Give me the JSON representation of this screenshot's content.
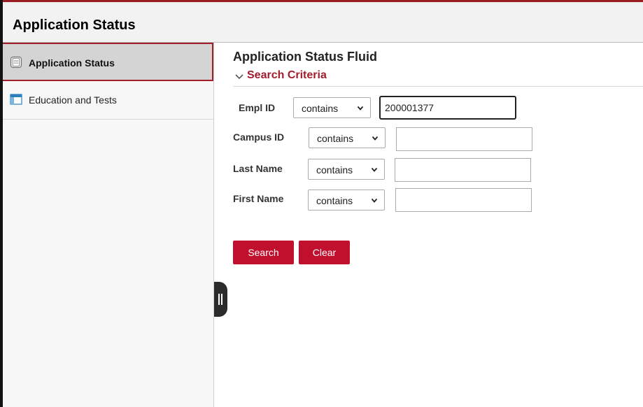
{
  "header": {
    "title": "Application Status"
  },
  "sidebar": {
    "items": [
      {
        "label": "Application Status",
        "icon": "document-icon",
        "active": true
      },
      {
        "label": "Education and Tests",
        "icon": "window-grid-icon",
        "active": false
      }
    ]
  },
  "main": {
    "page_title": "Application Status Fluid",
    "section_label": "Search Criteria",
    "fields": [
      {
        "label": "Empl ID",
        "operator": "contains",
        "value": "200001377"
      },
      {
        "label": "Campus ID",
        "operator": "contains",
        "value": ""
      },
      {
        "label": "Last Name",
        "operator": "contains",
        "value": ""
      },
      {
        "label": "First Name",
        "operator": "contains",
        "value": ""
      }
    ],
    "buttons": {
      "search": "Search",
      "clear": "Clear"
    }
  },
  "colors": {
    "accent": "#a11d2c",
    "button": "#c0102e",
    "header_bg": "#f2f2f2",
    "sidebar_active_bg": "#d4d4d4"
  }
}
